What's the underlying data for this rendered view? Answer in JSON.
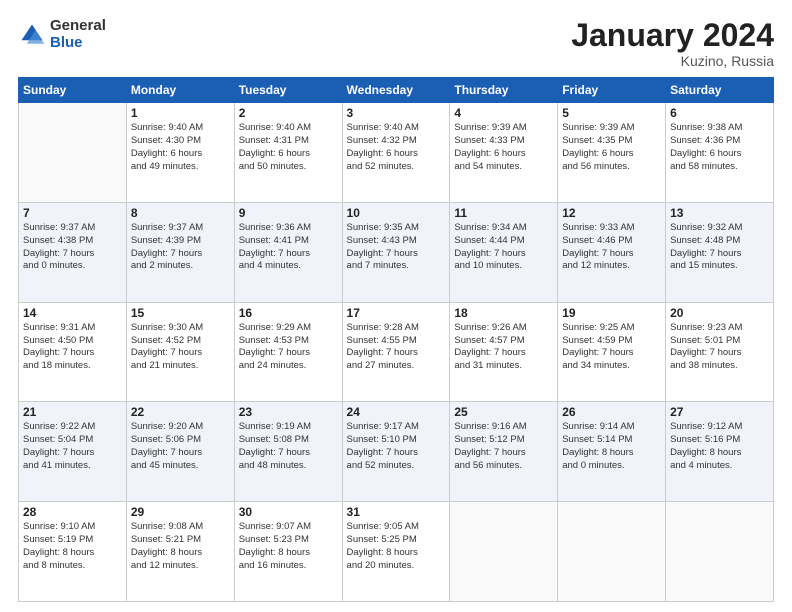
{
  "header": {
    "logo_general": "General",
    "logo_blue": "Blue",
    "month_title": "January 2024",
    "location": "Kuzino, Russia"
  },
  "weekdays": [
    "Sunday",
    "Monday",
    "Tuesday",
    "Wednesday",
    "Thursday",
    "Friday",
    "Saturday"
  ],
  "weeks": [
    [
      {
        "day": "",
        "info": ""
      },
      {
        "day": "1",
        "info": "Sunrise: 9:40 AM\nSunset: 4:30 PM\nDaylight: 6 hours\nand 49 minutes."
      },
      {
        "day": "2",
        "info": "Sunrise: 9:40 AM\nSunset: 4:31 PM\nDaylight: 6 hours\nand 50 minutes."
      },
      {
        "day": "3",
        "info": "Sunrise: 9:40 AM\nSunset: 4:32 PM\nDaylight: 6 hours\nand 52 minutes."
      },
      {
        "day": "4",
        "info": "Sunrise: 9:39 AM\nSunset: 4:33 PM\nDaylight: 6 hours\nand 54 minutes."
      },
      {
        "day": "5",
        "info": "Sunrise: 9:39 AM\nSunset: 4:35 PM\nDaylight: 6 hours\nand 56 minutes."
      },
      {
        "day": "6",
        "info": "Sunrise: 9:38 AM\nSunset: 4:36 PM\nDaylight: 6 hours\nand 58 minutes."
      }
    ],
    [
      {
        "day": "7",
        "info": "Sunrise: 9:37 AM\nSunset: 4:38 PM\nDaylight: 7 hours\nand 0 minutes."
      },
      {
        "day": "8",
        "info": "Sunrise: 9:37 AM\nSunset: 4:39 PM\nDaylight: 7 hours\nand 2 minutes."
      },
      {
        "day": "9",
        "info": "Sunrise: 9:36 AM\nSunset: 4:41 PM\nDaylight: 7 hours\nand 4 minutes."
      },
      {
        "day": "10",
        "info": "Sunrise: 9:35 AM\nSunset: 4:43 PM\nDaylight: 7 hours\nand 7 minutes."
      },
      {
        "day": "11",
        "info": "Sunrise: 9:34 AM\nSunset: 4:44 PM\nDaylight: 7 hours\nand 10 minutes."
      },
      {
        "day": "12",
        "info": "Sunrise: 9:33 AM\nSunset: 4:46 PM\nDaylight: 7 hours\nand 12 minutes."
      },
      {
        "day": "13",
        "info": "Sunrise: 9:32 AM\nSunset: 4:48 PM\nDaylight: 7 hours\nand 15 minutes."
      }
    ],
    [
      {
        "day": "14",
        "info": "Sunrise: 9:31 AM\nSunset: 4:50 PM\nDaylight: 7 hours\nand 18 minutes."
      },
      {
        "day": "15",
        "info": "Sunrise: 9:30 AM\nSunset: 4:52 PM\nDaylight: 7 hours\nand 21 minutes."
      },
      {
        "day": "16",
        "info": "Sunrise: 9:29 AM\nSunset: 4:53 PM\nDaylight: 7 hours\nand 24 minutes."
      },
      {
        "day": "17",
        "info": "Sunrise: 9:28 AM\nSunset: 4:55 PM\nDaylight: 7 hours\nand 27 minutes."
      },
      {
        "day": "18",
        "info": "Sunrise: 9:26 AM\nSunset: 4:57 PM\nDaylight: 7 hours\nand 31 minutes."
      },
      {
        "day": "19",
        "info": "Sunrise: 9:25 AM\nSunset: 4:59 PM\nDaylight: 7 hours\nand 34 minutes."
      },
      {
        "day": "20",
        "info": "Sunrise: 9:23 AM\nSunset: 5:01 PM\nDaylight: 7 hours\nand 38 minutes."
      }
    ],
    [
      {
        "day": "21",
        "info": "Sunrise: 9:22 AM\nSunset: 5:04 PM\nDaylight: 7 hours\nand 41 minutes."
      },
      {
        "day": "22",
        "info": "Sunrise: 9:20 AM\nSunset: 5:06 PM\nDaylight: 7 hours\nand 45 minutes."
      },
      {
        "day": "23",
        "info": "Sunrise: 9:19 AM\nSunset: 5:08 PM\nDaylight: 7 hours\nand 48 minutes."
      },
      {
        "day": "24",
        "info": "Sunrise: 9:17 AM\nSunset: 5:10 PM\nDaylight: 7 hours\nand 52 minutes."
      },
      {
        "day": "25",
        "info": "Sunrise: 9:16 AM\nSunset: 5:12 PM\nDaylight: 7 hours\nand 56 minutes."
      },
      {
        "day": "26",
        "info": "Sunrise: 9:14 AM\nSunset: 5:14 PM\nDaylight: 8 hours\nand 0 minutes."
      },
      {
        "day": "27",
        "info": "Sunrise: 9:12 AM\nSunset: 5:16 PM\nDaylight: 8 hours\nand 4 minutes."
      }
    ],
    [
      {
        "day": "28",
        "info": "Sunrise: 9:10 AM\nSunset: 5:19 PM\nDaylight: 8 hours\nand 8 minutes."
      },
      {
        "day": "29",
        "info": "Sunrise: 9:08 AM\nSunset: 5:21 PM\nDaylight: 8 hours\nand 12 minutes."
      },
      {
        "day": "30",
        "info": "Sunrise: 9:07 AM\nSunset: 5:23 PM\nDaylight: 8 hours\nand 16 minutes."
      },
      {
        "day": "31",
        "info": "Sunrise: 9:05 AM\nSunset: 5:25 PM\nDaylight: 8 hours\nand 20 minutes."
      },
      {
        "day": "",
        "info": ""
      },
      {
        "day": "",
        "info": ""
      },
      {
        "day": "",
        "info": ""
      }
    ]
  ]
}
